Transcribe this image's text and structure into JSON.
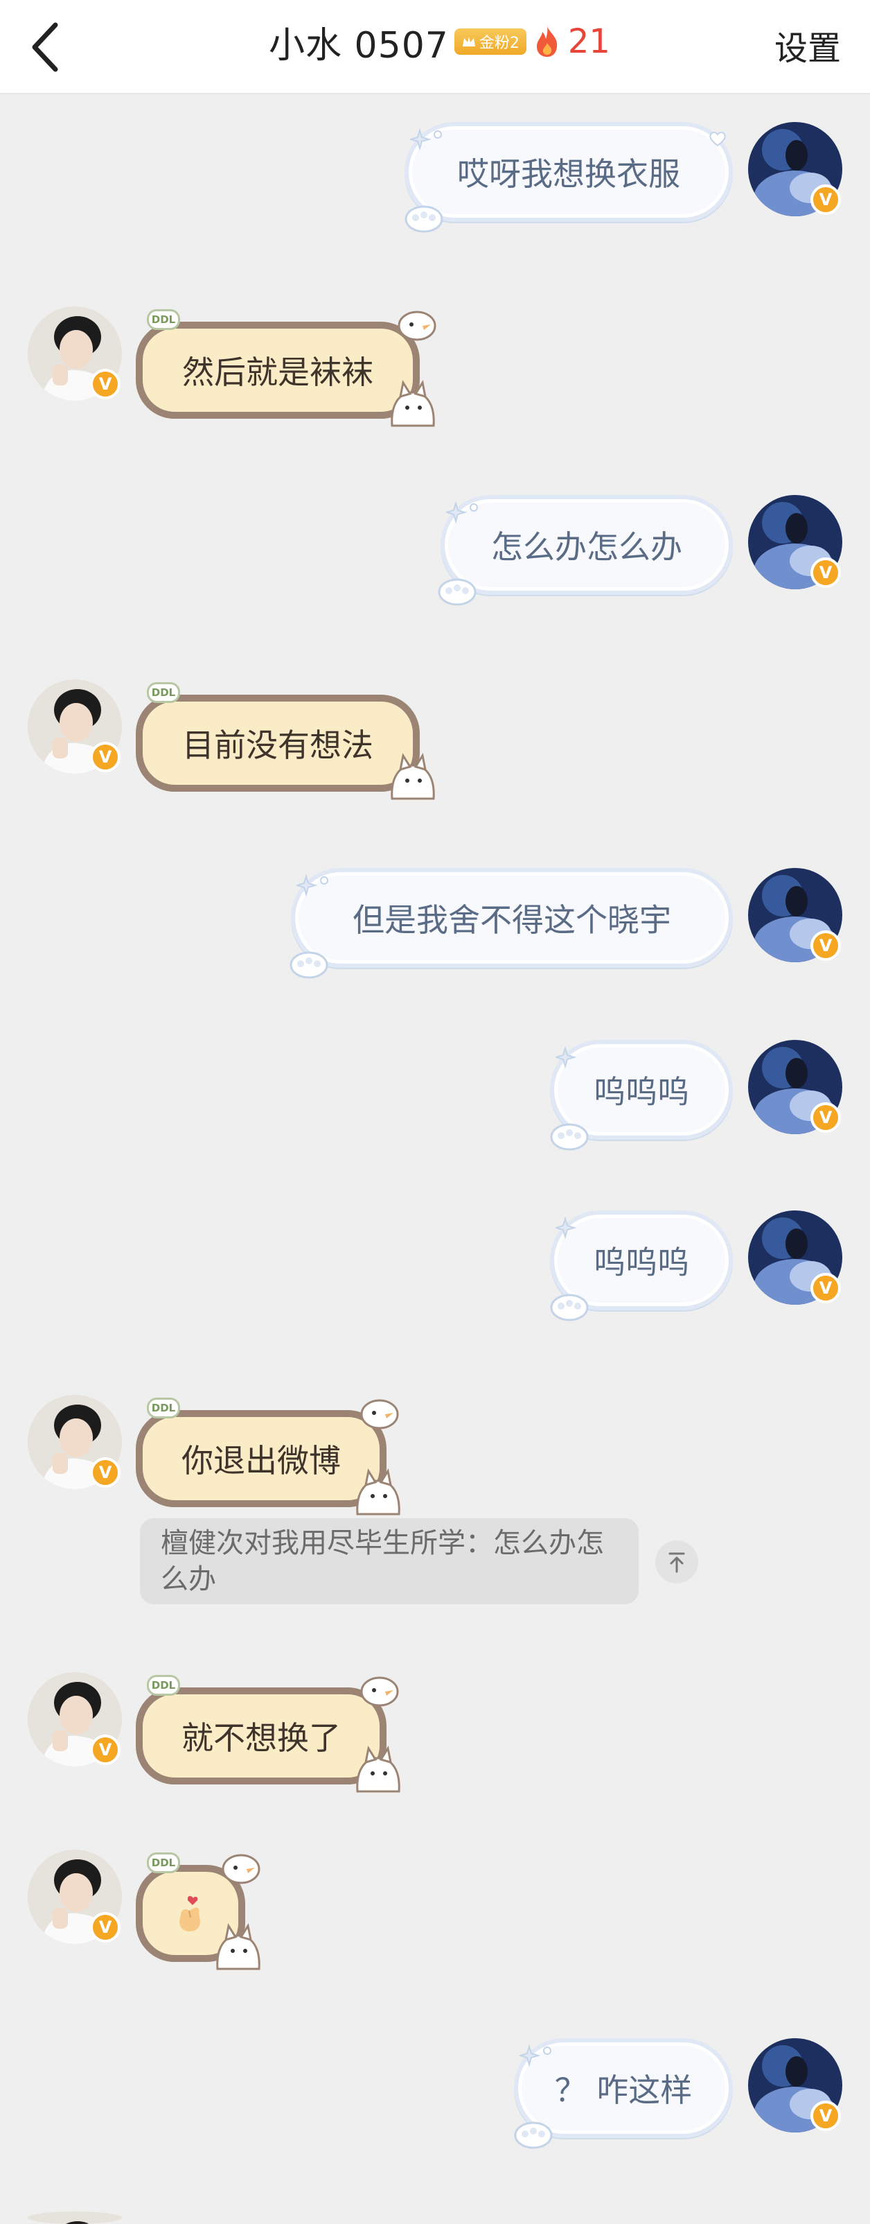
{
  "header": {
    "title": "小水 0507",
    "fan_badge": "金粉2",
    "fire_count": "21",
    "settings_label": "设置"
  },
  "messages": [
    {
      "side": "right",
      "text": "哎呀我想换衣服"
    },
    {
      "side": "left",
      "text": "然后就是袜袜"
    },
    {
      "side": "right",
      "text": "怎么办怎么办"
    },
    {
      "side": "left",
      "text": "目前没有想法"
    },
    {
      "side": "right",
      "text": "但是我舍不得这个晓宇"
    },
    {
      "side": "right",
      "text": "呜呜呜"
    },
    {
      "side": "right",
      "text": "呜呜呜"
    },
    {
      "side": "left",
      "text": "你退出微博"
    },
    {
      "side": "left",
      "text": "就不想换了"
    },
    {
      "side": "left",
      "text": "",
      "emoji": "finger-heart"
    },
    {
      "side": "right",
      "text": "？ 咋这样"
    }
  ],
  "quote": {
    "text": "檀健次对我用尽毕生所学：怎么办怎么办"
  },
  "badge_letter": "V",
  "bubble_tag": "DDL",
  "colors": {
    "vip_badge": "#f5a623",
    "fire": "#e6463a",
    "left_bubble_fill": "#f9ecc6",
    "left_bubble_border": "#9b8474",
    "right_bubble_fill": "#f7f9fd",
    "right_bubble_text": "#5a6b85"
  }
}
